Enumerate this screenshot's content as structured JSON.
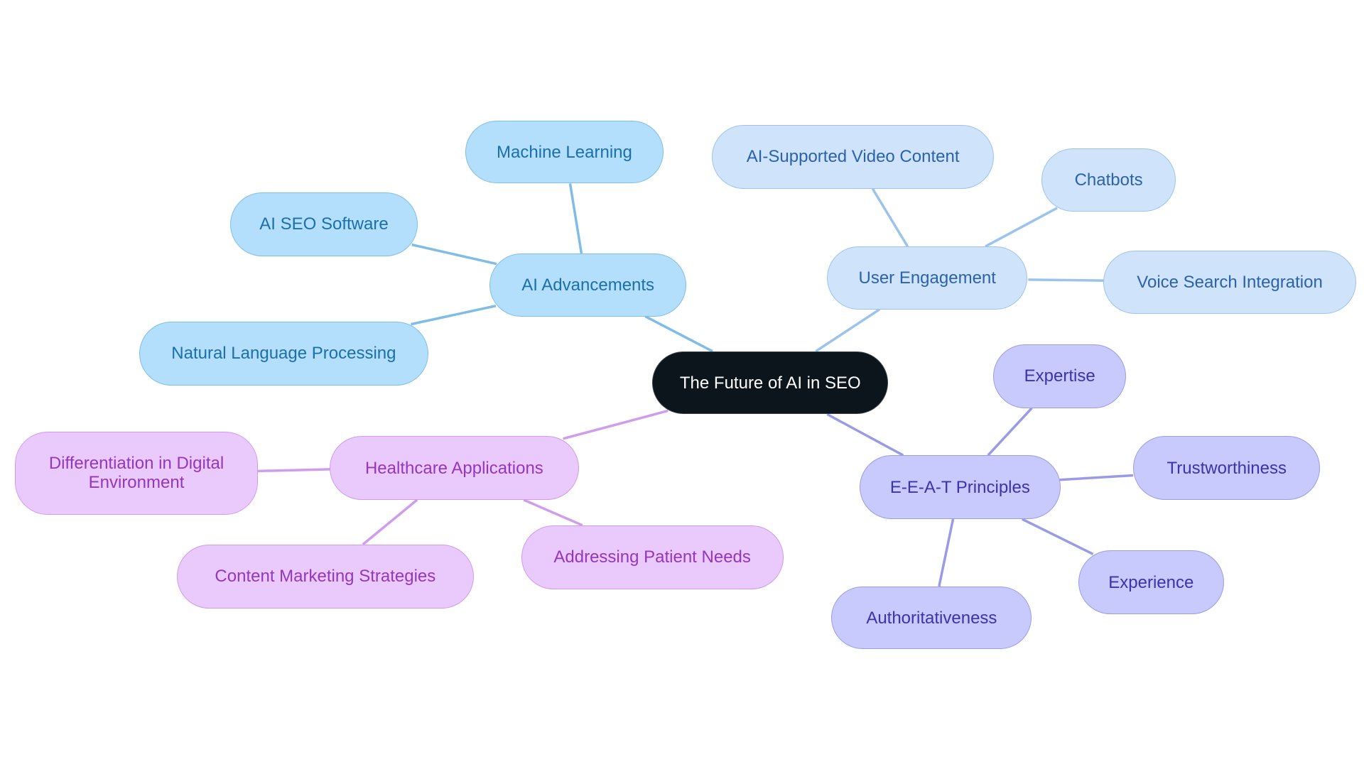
{
  "root": {
    "id": "root",
    "label": "The Future of AI in SEO"
  },
  "colors": {
    "root": "#0c141c",
    "branch_ai_advancements": {
      "fill": "#b3dffc",
      "stroke": "#80bfe6",
      "text": "#1a6fad",
      "edge": "#7fbde6"
    },
    "branch_user_engagement": {
      "fill": "#cfe4fb",
      "stroke": "#9dc3ec",
      "text": "#2b62ae",
      "edge": "#9cc3ec"
    },
    "branch_eeat": {
      "fill": "#c8c9fd",
      "stroke": "#9c9de6",
      "text": "#3a34ae",
      "edge": "#9a9be6"
    },
    "branch_healthcare": {
      "fill": "#eacafc",
      "stroke": "#cd9ced",
      "text": "#9536bf",
      "edge": "#cf9dec"
    }
  },
  "branches": [
    {
      "id": "ai-advancements",
      "label": "AI Advancements",
      "style": "b-blue",
      "children": [
        {
          "id": "machine-learning",
          "label": "Machine Learning"
        },
        {
          "id": "ai-seo-software",
          "label": "AI SEO Software"
        },
        {
          "id": "natural-language-processing",
          "label": "Natural Language Processing"
        }
      ]
    },
    {
      "id": "user-engagement",
      "label": "User Engagement",
      "style": "b-light",
      "children": [
        {
          "id": "ai-supported-video-content",
          "label": "AI-Supported Video Content"
        },
        {
          "id": "chatbots",
          "label": "Chatbots"
        },
        {
          "id": "voice-search-integration",
          "label": "Voice Search Integration"
        }
      ]
    },
    {
      "id": "eeat-principles",
      "label": "E-E-A-T Principles",
      "style": "b-lav",
      "children": [
        {
          "id": "expertise",
          "label": "Expertise"
        },
        {
          "id": "trustworthiness",
          "label": "Trustworthiness"
        },
        {
          "id": "experience",
          "label": "Experience"
        },
        {
          "id": "authoritativeness",
          "label": "Authoritativeness"
        }
      ]
    },
    {
      "id": "healthcare-applications",
      "label": "Healthcare Applications",
      "style": "b-pink",
      "children": [
        {
          "id": "differentiation-in-digital-environment",
          "label": "Differentiation in Digital Environment"
        },
        {
          "id": "content-marketing-strategies",
          "label": "Content Marketing Strategies"
        },
        {
          "id": "addressing-patient-needs",
          "label": "Addressing Patient Needs"
        }
      ]
    }
  ]
}
